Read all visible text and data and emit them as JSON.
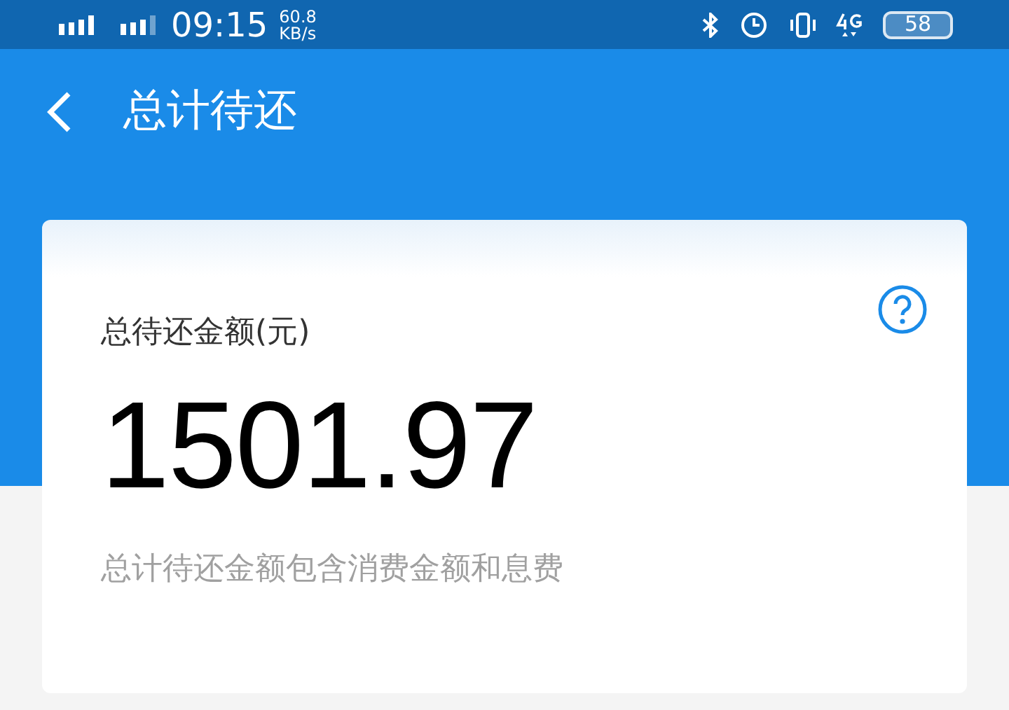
{
  "status_bar": {
    "time": "09:15",
    "speed": "60.8",
    "speed_unit": "KB/s",
    "battery": "58"
  },
  "header": {
    "title": "总计待还"
  },
  "card": {
    "label": "总待还金额(元)",
    "amount": "1501.97",
    "note": "总计待还金额包含消费金额和息费"
  }
}
